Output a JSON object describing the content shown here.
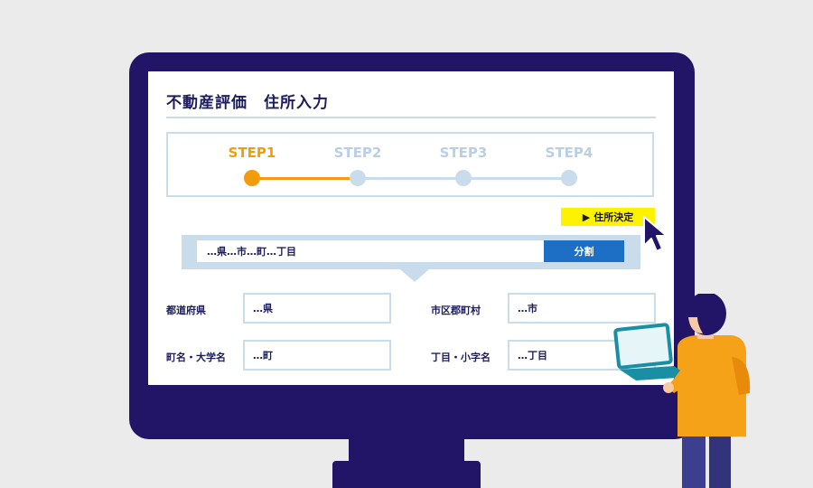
{
  "header": {
    "title": "不動産評価　住所入力"
  },
  "steps": [
    {
      "label": "STEP1",
      "state": "active"
    },
    {
      "label": "STEP2",
      "state": "pending"
    },
    {
      "label": "STEP3",
      "state": "pending"
    },
    {
      "label": "STEP4",
      "state": "pending"
    }
  ],
  "colors": {
    "active": "#f29b0c",
    "pending": "#c9dcec",
    "pending_text": "#b9cfe4",
    "navy": "#221466",
    "accent_blue": "#1c6fc4",
    "yellow": "#fff200"
  },
  "decide_button": {
    "label": "住所決定",
    "icon": "play-triangle-icon"
  },
  "address": {
    "value": "…県…市…町…丁目",
    "split_label": "分割"
  },
  "fields": {
    "prefecture": {
      "label": "都道府県",
      "value": "…県"
    },
    "city": {
      "label": "市区郡町村",
      "value": "…市"
    },
    "town": {
      "label": "町名・大学名",
      "value": "…町"
    },
    "chome": {
      "label": "丁目・小字名",
      "value": "…丁目"
    }
  }
}
